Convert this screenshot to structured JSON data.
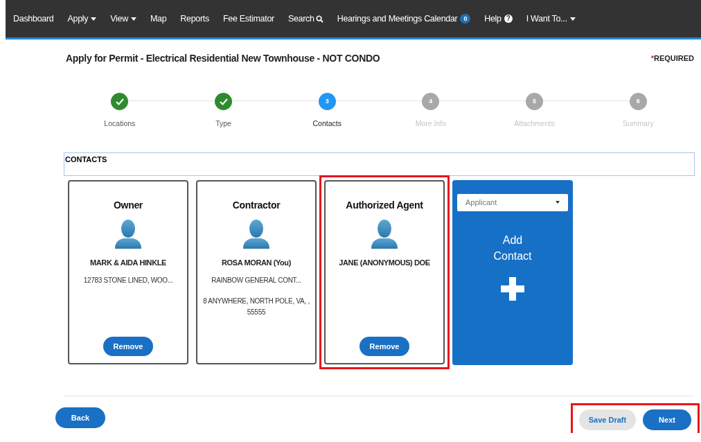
{
  "nav": [
    {
      "label": "Dashboard",
      "kind": "link"
    },
    {
      "label": "Apply",
      "kind": "dropdown"
    },
    {
      "label": "View",
      "kind": "dropdown"
    },
    {
      "label": "Map",
      "kind": "link"
    },
    {
      "label": "Reports",
      "kind": "link"
    },
    {
      "label": "Fee Estimator",
      "kind": "link"
    },
    {
      "label": "Search",
      "kind": "search"
    },
    {
      "label": "Hearings and Meetings Calendar",
      "kind": "badge",
      "badge": "0"
    },
    {
      "label": "Help",
      "kind": "help",
      "icon": "?"
    },
    {
      "label": "I Want To...",
      "kind": "dropdown"
    }
  ],
  "title": "Apply for Permit - Electrical Residential New Townhouse - NOT CONDO",
  "required": {
    "mark": "*",
    "label": "REQUIRED"
  },
  "steps": [
    {
      "label": "Locations",
      "completed": true,
      "selected": false
    },
    {
      "label": "Type",
      "completed": true,
      "selected": false
    },
    {
      "number": "3",
      "label": "Contacts",
      "completed": false,
      "selected": true
    },
    {
      "number": "4",
      "label": "More Info",
      "completed": false,
      "selected": false
    },
    {
      "number": "5",
      "label": "Attachments",
      "completed": false,
      "selected": false
    },
    {
      "number": "6",
      "label": "Summary",
      "completed": false,
      "selected": false
    }
  ],
  "section_title": "CONTACTS",
  "contacts": [
    {
      "role": "Owner",
      "name": "MARK & AIDA HINKLE",
      "lines": [
        "12783 STONE LINED, WOO..."
      ],
      "button": "Remove",
      "highlighted": false
    },
    {
      "role": "Contractor",
      "name": "ROSA MORAN (You)",
      "lines": [
        "RAINBOW GENERAL CONT...",
        "8 ANYWHERE, NORTH POLE, VA, , 55555"
      ],
      "highlighted": false
    },
    {
      "role": "Authorized Agent",
      "name": "JANE (ANONYMOUS) DOE",
      "button": "Remove",
      "highlighted": true
    }
  ],
  "add_contact": {
    "select_value": "Applicant",
    "label": "Add Contact"
  },
  "footer": {
    "back": "Back",
    "save_draft": "Save Draft",
    "next": "Next",
    "actions_highlighted": true
  }
}
